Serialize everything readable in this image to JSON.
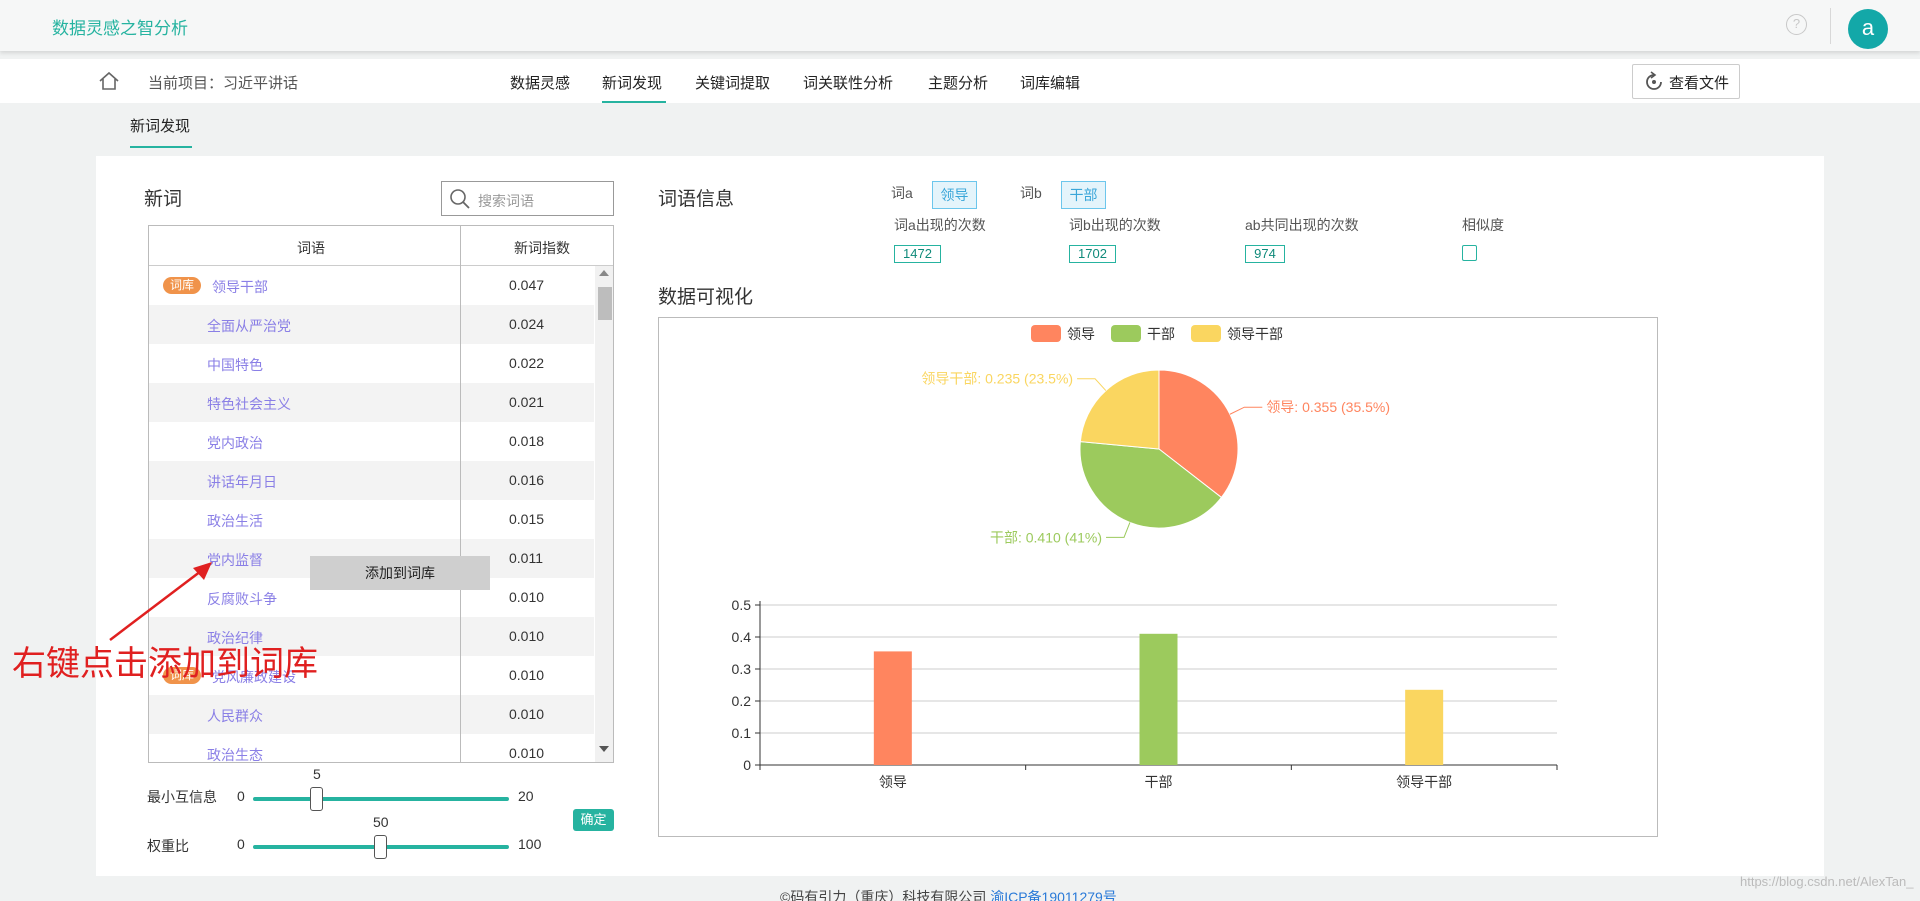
{
  "app": {
    "brand": "数据灵感之智分析",
    "help_icon": "question-circle-icon",
    "avatar_letter": "a",
    "avatar_color": "#13a8a8"
  },
  "nav": {
    "home_icon": "home-icon",
    "project": "当前项目：习近平讲话",
    "items": [
      {
        "label": "数据灵感",
        "active": false
      },
      {
        "label": "新词发现",
        "active": true
      },
      {
        "label": "关键词提取",
        "active": false
      },
      {
        "label": "词关联性分析",
        "active": false
      },
      {
        "label": "主题分析",
        "active": false
      },
      {
        "label": "词库编辑",
        "active": false
      }
    ],
    "file_button": "查看文件",
    "subtab": "新词发现",
    "accent_color": "#26b3a0"
  },
  "newwords": {
    "title": "新词",
    "search_placeholder": "搜索词语",
    "columns": [
      "词语",
      "新词指数"
    ],
    "tag_label": "词库",
    "rows": [
      {
        "word": "领导干部",
        "score": "0.047",
        "tag": true
      },
      {
        "word": "全面从严治党",
        "score": "0.024",
        "tag": false
      },
      {
        "word": "中国特色",
        "score": "0.022",
        "tag": false
      },
      {
        "word": "特色社会主义",
        "score": "0.021",
        "tag": false
      },
      {
        "word": "党内政治",
        "score": "0.018",
        "tag": false
      },
      {
        "word": "讲话年月日",
        "score": "0.016",
        "tag": false
      },
      {
        "word": "政治生活",
        "score": "0.015",
        "tag": false
      },
      {
        "word": "党内监督",
        "score": "0.011",
        "tag": false
      },
      {
        "word": "反腐败斗争",
        "score": "0.010",
        "tag": false
      },
      {
        "word": "政治纪律",
        "score": "0.010",
        "tag": false
      },
      {
        "word": "党风廉政建设",
        "score": "0.010",
        "tag": true
      },
      {
        "word": "人民群众",
        "score": "0.010",
        "tag": false
      },
      {
        "word": "政治生态",
        "score": "0.010",
        "tag": false
      }
    ],
    "context_menu": "添加到词库",
    "annotation": "右键点击添加到词库",
    "sliders": [
      {
        "label": "最小互信息",
        "min": "0",
        "max": "20",
        "value": "5",
        "fraction": 0.25
      },
      {
        "label": "权重比",
        "min": "0",
        "max": "100",
        "value": "50",
        "fraction": 0.5
      }
    ],
    "confirm_button": "确定"
  },
  "wordinfo": {
    "title": "词语信息",
    "word_a_label": "词a",
    "word_a": "领导",
    "word_b_label": "词b",
    "word_b": "干部",
    "stats": [
      {
        "label": "词a出现的次数",
        "value": "1472"
      },
      {
        "label": "词b出现的次数",
        "value": "1702"
      },
      {
        "label": "ab共同出现的次数",
        "value": "974"
      },
      {
        "label": "相似度",
        "value": ""
      }
    ]
  },
  "viz": {
    "title": "数据可视化"
  },
  "chart_data": [
    {
      "type": "pie",
      "categories": [
        "领导",
        "干部",
        "领导干部"
      ],
      "values": [
        0.355,
        0.41,
        0.235
      ],
      "labels": [
        "领导: 0.355 (35.5%)",
        "干部: 0.410 (41%)",
        "领导干部: 0.235 (23.5%)"
      ],
      "colors": [
        "#ff855f",
        "#9cca5d",
        "#fad660"
      ],
      "legend": "top-center"
    },
    {
      "type": "bar",
      "categories": [
        "领导",
        "干部",
        "领导干部"
      ],
      "values": [
        0.355,
        0.41,
        0.235
      ],
      "colors": [
        "#ff855f",
        "#9cca5d",
        "#fad660"
      ],
      "ylim": [
        0,
        0.5
      ],
      "yticks": [
        "0",
        "0.1",
        "0.2",
        "0.3",
        "0.4",
        "0.5"
      ],
      "grid": true
    }
  ],
  "footer": {
    "text": "©码有引力（重庆）科技有限公司",
    "link": "渝ICP备19011279号"
  },
  "watermark": "https://blog.csdn.net/AlexTan_"
}
